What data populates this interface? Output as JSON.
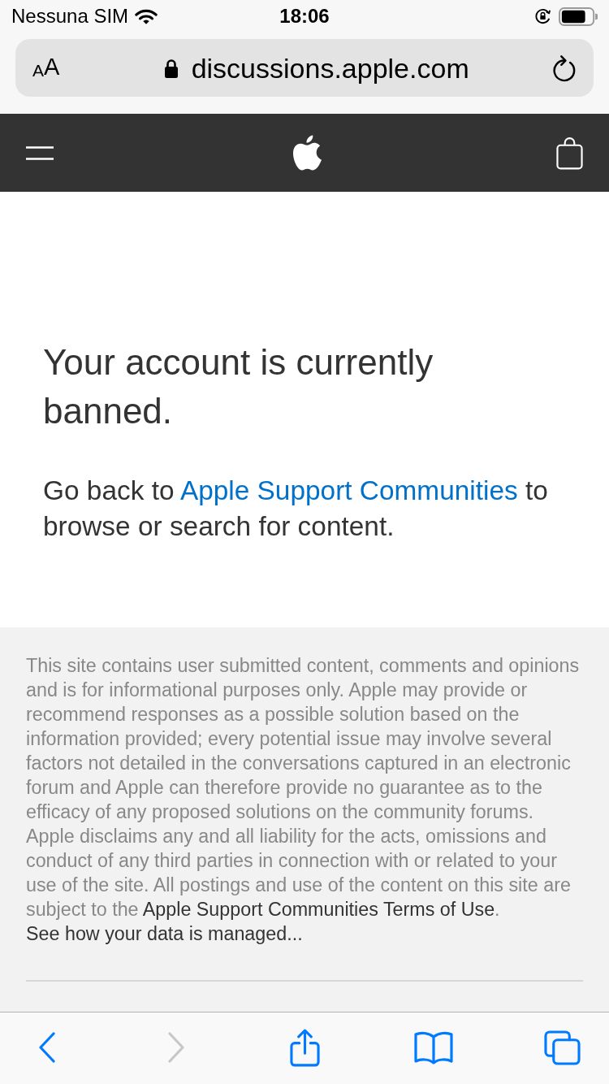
{
  "status_bar": {
    "carrier": "Nessuna SIM",
    "time": "18:06"
  },
  "address_bar": {
    "text_size_button": "AA",
    "url": "discussions.apple.com"
  },
  "main": {
    "heading": "Your account is currently banned.",
    "message": [
      {
        "kind": "text",
        "text": "Go back to "
      },
      {
        "kind": "link",
        "text": "Apple Support Communities"
      },
      {
        "kind": "text",
        "text": " to browse or search for content."
      }
    ]
  },
  "footer": {
    "disclaimer": [
      {
        "kind": "text",
        "text": "This site contains user submitted content, comments and opinions and is for informational purposes only. Apple may provide or recommend responses as a possible solution based on the information provided; every potential issue may involve several factors not detailed in the conversations captured in an electronic forum and Apple can therefore provide no guarantee as to the efficacy of any proposed solutions on the community forums. Apple disclaims any and all liability for the acts, omissions and conduct of any third parties in connection with or related to your use of the site. All postings and use of the content on this site are subject to the "
      },
      {
        "kind": "link",
        "text": "Apple Support Communities Terms of Use"
      },
      {
        "kind": "text",
        "text": ". "
      },
      {
        "kind": "link",
        "text": "See how your data is managed..."
      }
    ]
  },
  "toolbar": [
    {
      "kind": "back",
      "disabled": false
    },
    {
      "kind": "forward",
      "disabled": true
    },
    {
      "kind": "share",
      "disabled": false
    },
    {
      "kind": "bookmarks",
      "disabled": false
    },
    {
      "kind": "tabs",
      "disabled": false
    }
  ]
}
